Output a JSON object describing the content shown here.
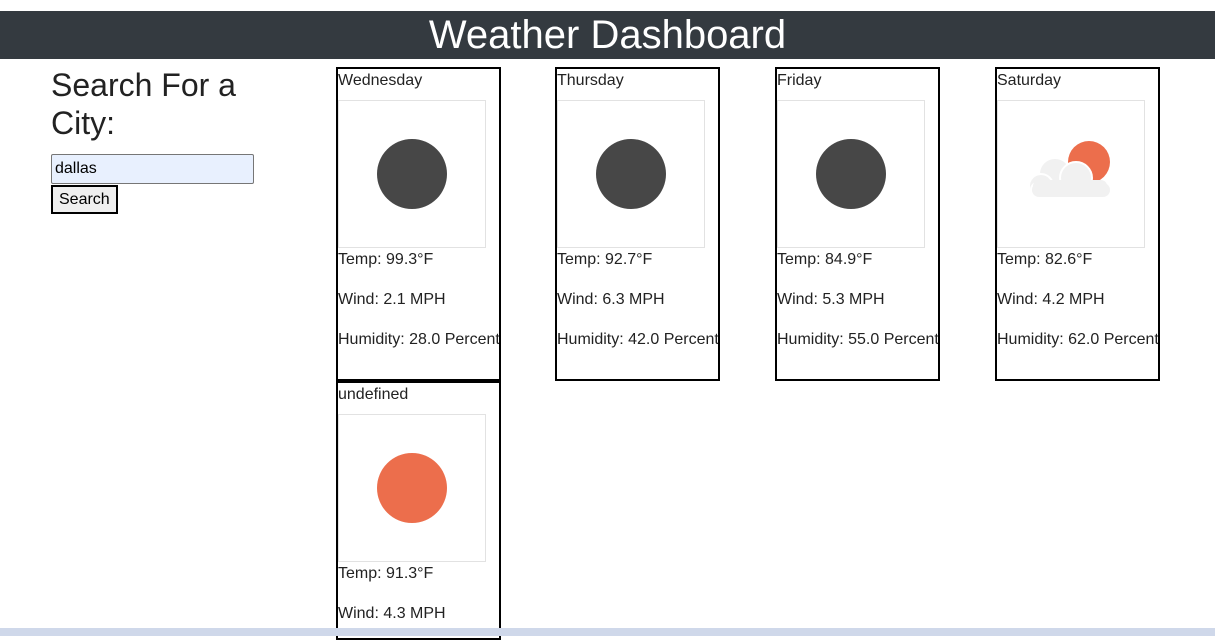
{
  "header": {
    "title": "Weather Dashboard"
  },
  "search": {
    "title": "Search For a City:",
    "input_value": "dallas",
    "button_label": "Search"
  },
  "colors": {
    "header_bg": "#343a40",
    "moon": "#474747",
    "sun": "#ec6e4c",
    "cloud": "#f1f1f1"
  },
  "forecast": [
    {
      "day": "Wednesday",
      "icon": "clear-night-icon",
      "temp": "Temp: 99.3°F",
      "wind": "Wind: 2.1 MPH",
      "humidity": "Humidity: 28.0 Percent"
    },
    {
      "day": "Thursday",
      "icon": "clear-night-icon",
      "temp": "Temp: 92.7°F",
      "wind": "Wind: 6.3 MPH",
      "humidity": "Humidity: 42.0 Percent"
    },
    {
      "day": "Friday",
      "icon": "clear-night-icon",
      "temp": "Temp: 84.9°F",
      "wind": "Wind: 5.3 MPH",
      "humidity": "Humidity: 55.0 Percent"
    },
    {
      "day": "Saturday",
      "icon": "partly-cloudy-day-icon",
      "temp": "Temp: 82.6°F",
      "wind": "Wind: 4.2 MPH",
      "humidity": "Humidity: 62.0 Percent"
    },
    {
      "day": "undefined",
      "icon": "clear-day-icon",
      "temp": "Temp: 91.3°F",
      "wind": "Wind: 4.3 MPH",
      "humidity": ""
    }
  ]
}
